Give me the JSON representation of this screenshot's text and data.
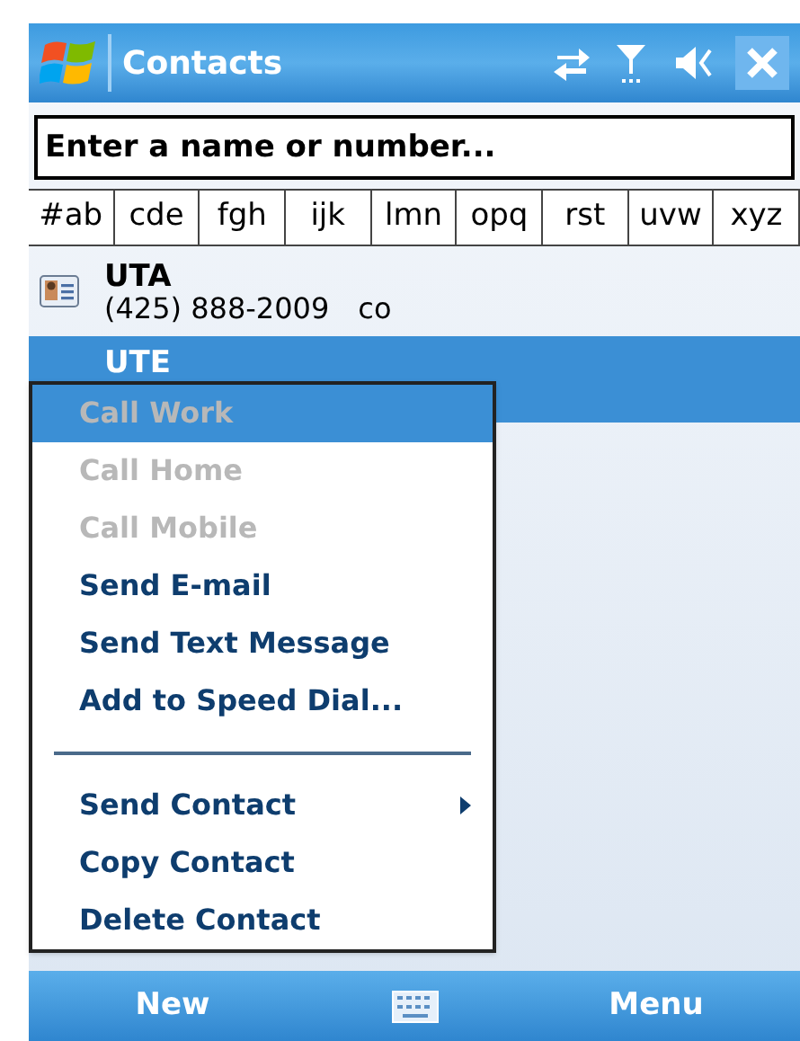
{
  "title_bar": {
    "title": "Contacts"
  },
  "search": {
    "placeholder": "Enter a name or number..."
  },
  "letter_tabs": [
    "#ab",
    "cde",
    "fgh",
    "ijk",
    "lmn",
    "opq",
    "rst",
    "uvw",
    "xyz"
  ],
  "contacts": [
    {
      "name": "UTA",
      "phone": "(425) 888-2009",
      "phone_type": "co",
      "has_icon": true,
      "selected": false
    },
    {
      "name": "UTE",
      "has_icon": false,
      "selected": true
    }
  ],
  "context_menu": [
    {
      "kind": "item",
      "label": "Call Work",
      "disabled": true,
      "selected": true
    },
    {
      "kind": "item",
      "label": "Call Home",
      "disabled": true,
      "selected": false
    },
    {
      "kind": "item",
      "label": "Call Mobile",
      "disabled": true,
      "selected": false
    },
    {
      "kind": "item",
      "label": "Send E-mail",
      "disabled": false,
      "selected": false
    },
    {
      "kind": "item",
      "label": "Send Text Message",
      "disabled": false,
      "selected": false
    },
    {
      "kind": "item",
      "label": "Add to Speed Dial...",
      "disabled": false,
      "selected": false
    },
    {
      "kind": "separator"
    },
    {
      "kind": "submenu",
      "label": "Send Contact",
      "disabled": false,
      "selected": false
    },
    {
      "kind": "item",
      "label": "Copy Contact",
      "disabled": false,
      "selected": false
    },
    {
      "kind": "item",
      "label": "Delete Contact",
      "disabled": false,
      "selected": false
    }
  ],
  "soft_keys": {
    "left": "New",
    "right": "Menu"
  }
}
